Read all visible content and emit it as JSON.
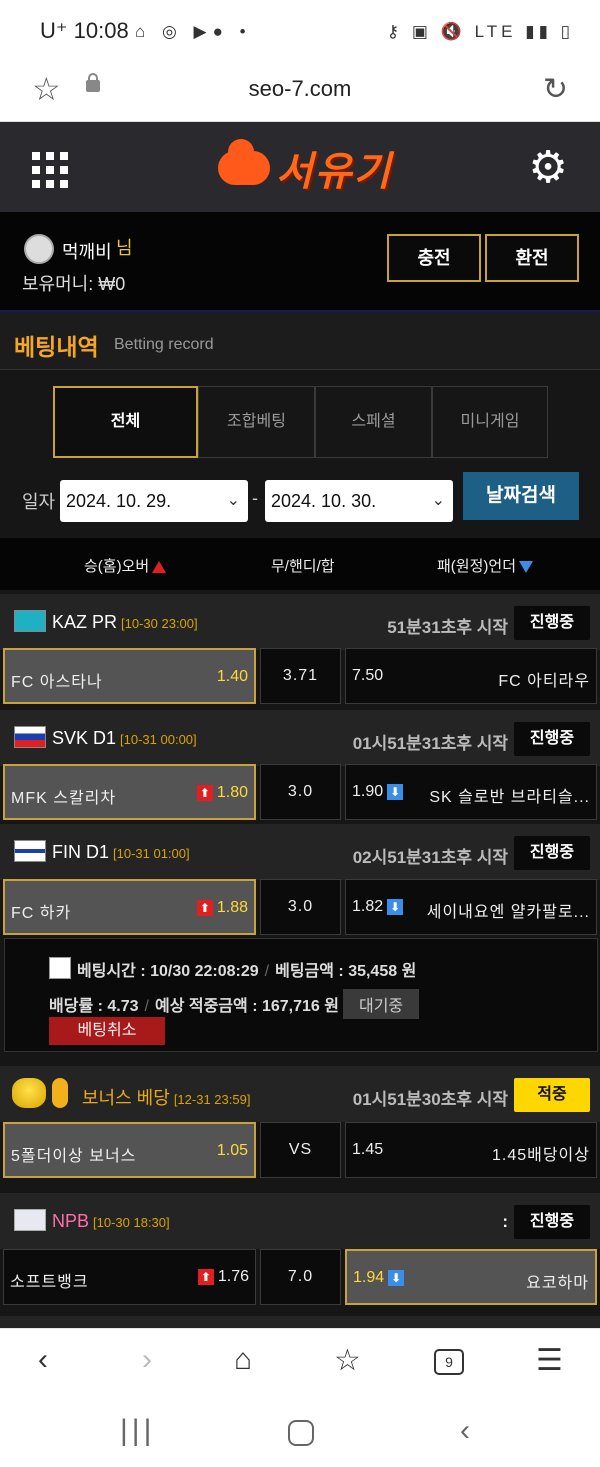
{
  "status_bar": {
    "time": "10:08",
    "carrier": "U⁺",
    "left_icons": "⌂ ◎ ▶●  •",
    "right_icons": "⚷ ▣ 🔇 LTE ▮▮ ▯"
  },
  "browser": {
    "url": "seo-7.com"
  },
  "header": {
    "logo_text": "서유기"
  },
  "user": {
    "name": "먹깨비",
    "suffix": "님",
    "money_label": "보유머니:",
    "money": "₩0",
    "charge_label": "충전",
    "exchange_label": "환전"
  },
  "section": {
    "title": "베팅내역",
    "subtitle": "Betting record"
  },
  "tabs": [
    "전체",
    "조합베팅",
    "스페셜",
    "미니게임"
  ],
  "date_filter": {
    "label": "일자",
    "from": "2024. 10. 29.",
    "to": "2024. 10. 30.",
    "separator": "-",
    "search_label": "날짜검색"
  },
  "columns": {
    "home": "승(홈)오버",
    "mid": "무/핸디/합",
    "away": "패(원정)언더"
  },
  "games": [
    {
      "league": "KAZ PR",
      "date": "[10-30 23:00]",
      "remaining": "51분31초후 시작",
      "status": "진행중",
      "home": "FC 아스타나",
      "home_odds": "1.40",
      "mid": "3.71",
      "away_odds": "7.50",
      "away": "FC 아티라우"
    },
    {
      "league": "SVK D1",
      "date": "[10-31 00:00]",
      "remaining": "01시51분31초후 시작",
      "status": "진행중",
      "home": "MFK 스칼리차",
      "home_odds": "1.80",
      "mid": "3.0",
      "away_odds": "1.90",
      "away": "SK 슬로반 브라티슬..."
    },
    {
      "league": "FIN D1",
      "date": "[10-31 01:00]",
      "remaining": "02시51분31초후 시작",
      "status": "진행중",
      "home": "FC 하카",
      "home_odds": "1.88",
      "mid": "3.0",
      "away_odds": "1.82",
      "away": "세이내요엔 얄카팔로..."
    },
    {
      "league": "보너스 베당",
      "date": "[12-31 23:59]",
      "remaining": "01시51분30초후 시작",
      "status": "적중",
      "home": "5폴더이상 보너스",
      "home_odds": "1.05",
      "mid": "VS",
      "away_odds": "1.45",
      "away": "1.45배당이상"
    },
    {
      "league": "NPB",
      "date": "[10-30 18:30]",
      "remaining": ":",
      "status": "진행중",
      "home": "소프트뱅크",
      "home_odds": "1.76",
      "mid": "7.0",
      "away_odds": "1.94",
      "away": "요코하마"
    }
  ],
  "bet_info": {
    "time_label": "베팅시간 : 10/30 22:08:29",
    "amount_label": "베팅금액 : 35,458 원",
    "rate_label": "배당률 : 4.73",
    "expected_label": "예상 적중금액 : 167,716 원",
    "wait_label": "대기중",
    "cancel_label": "베팅취소"
  },
  "colors": {
    "gold": "#c9a23a",
    "odds_yellow": "#ffd83a",
    "orange": "#f5a623",
    "search_blue": "#1e5f86",
    "cancel_red": "#a8191a"
  },
  "nav": {
    "tab_count": "9"
  }
}
